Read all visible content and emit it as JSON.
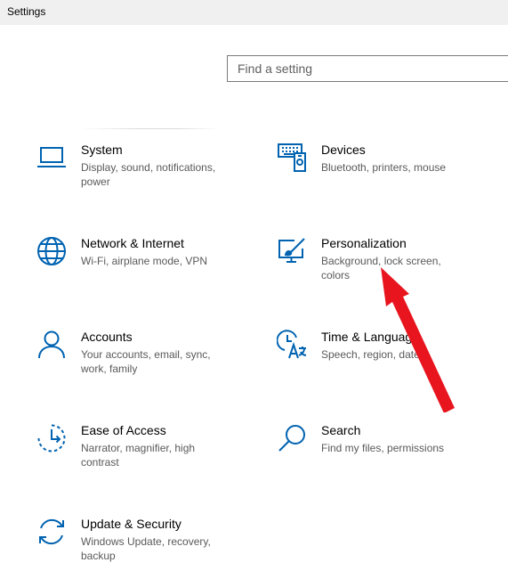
{
  "window": {
    "title": "Settings"
  },
  "search": {
    "placeholder": "Find a setting"
  },
  "tiles": [
    {
      "name": "System",
      "desc": "Display, sound, notifications, power",
      "icon": "laptop-icon"
    },
    {
      "name": "Devices",
      "desc": "Bluetooth, printers, mouse",
      "icon": "devices-icon"
    },
    {
      "name": "Network & Internet",
      "desc": "Wi-Fi, airplane mode, VPN",
      "icon": "globe-icon"
    },
    {
      "name": "Personalization",
      "desc": "Background, lock screen, colors",
      "icon": "paint-icon"
    },
    {
      "name": "Accounts",
      "desc": "Your accounts, email, sync, work, family",
      "icon": "person-icon"
    },
    {
      "name": "Time & Language",
      "desc": "Speech, region, date",
      "icon": "time-language-icon"
    },
    {
      "name": "Ease of Access",
      "desc": "Narrator, magnifier, high contrast",
      "icon": "ease-of-access-icon"
    },
    {
      "name": "Search",
      "desc": "Find my files, permissions",
      "icon": "search-icon"
    },
    {
      "name": "Update & Security",
      "desc": "Windows Update, recovery, backup",
      "icon": "update-icon"
    }
  ],
  "colors": {
    "accent": "#0063b1",
    "annotation_arrow": "#e8141e"
  }
}
